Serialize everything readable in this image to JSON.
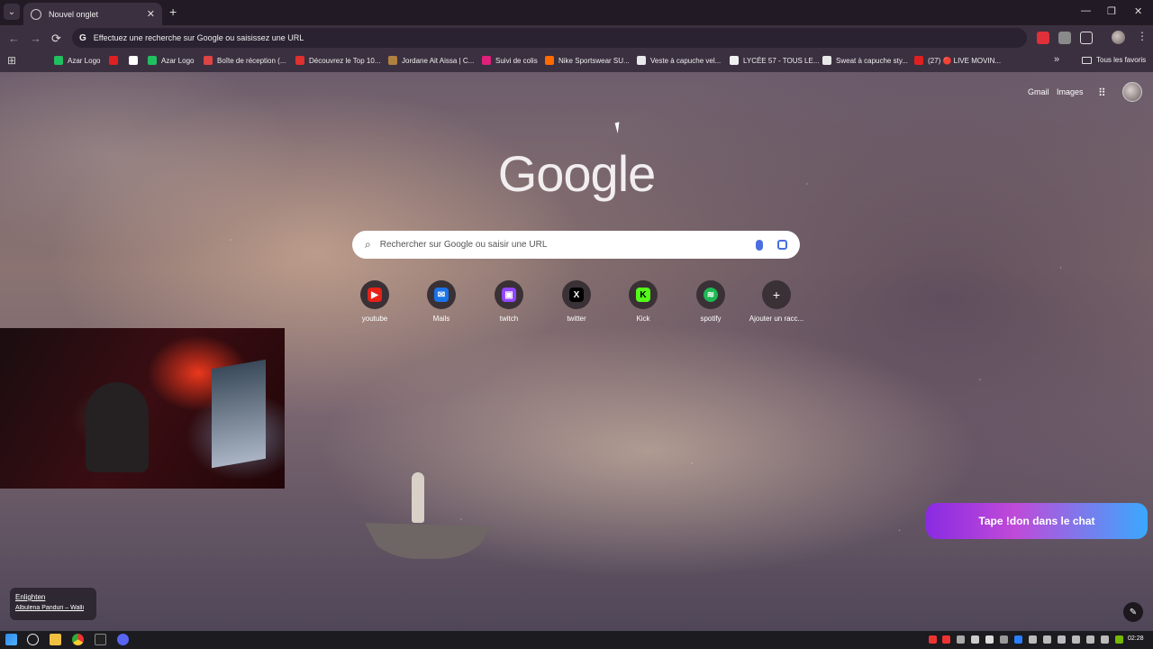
{
  "browser": {
    "tab_title": "Nouvel onglet",
    "tab_close": "✕",
    "new_tab": "+",
    "window_controls": [
      "—",
      "❐",
      "✕"
    ],
    "tab_search": "⌄"
  },
  "toolbar": {
    "back": "←",
    "forward": "→",
    "reload": "⟳",
    "omnibox_g": "G",
    "omnibox_placeholder": "Effectuez une recherche sur Google ou saisissez une URL",
    "menu": "⋮"
  },
  "bookmarks": {
    "items": [
      {
        "label": "Azar Logo",
        "color": "#20c060"
      },
      {
        "label": "",
        "color": "#e02020"
      },
      {
        "label": "",
        "color": "#ffffff"
      },
      {
        "label": "Azar Logo",
        "color": "#20c060"
      },
      {
        "label": "Boîte de réception (...",
        "color": "#d44"
      },
      {
        "label": "Découvrez le Top 10...",
        "color": "#e03030"
      },
      {
        "label": "Jordane Ait Aissa | C...",
        "color": "#b08040"
      },
      {
        "label": "Suivi de colis",
        "color": "#e0207a"
      },
      {
        "label": "Nike Sportswear SU...",
        "color": "#ff6a00"
      },
      {
        "label": "Veste à capuche vel...",
        "color": "#e8e8e8"
      },
      {
        "label": "LYCÉE 57 - TOUS LE...",
        "color": "#f0f0f0"
      },
      {
        "label": "Sweat à capuche sty...",
        "color": "#e8e8e8"
      },
      {
        "label": "(27) 🔴 LIVE MOVIN...",
        "color": "#e02020"
      }
    ],
    "more": "»",
    "all_favorites": "Tous les favoris"
  },
  "header_links": {
    "gmail": "Gmail",
    "images": "Images",
    "apps": "⋮⋮⋮"
  },
  "logo": "Google",
  "search": {
    "icon": "🔍",
    "placeholder": "Rechercher sur Google ou saisir une URL"
  },
  "shortcuts": [
    {
      "label": "youtube",
      "glyph": "▶",
      "color": "#e62117"
    },
    {
      "label": "Mails",
      "glyph": "✉",
      "color": "#1a73e8"
    },
    {
      "label": "twitch",
      "glyph": "▣",
      "color": "#9146ff"
    },
    {
      "label": "twitter",
      "glyph": "X",
      "color": "#000000"
    },
    {
      "label": "Kick",
      "glyph": "K",
      "color": "#53fc18"
    },
    {
      "label": "spotify",
      "glyph": "≋",
      "color": "#1db954"
    },
    {
      "label": "Ajouter un racc...",
      "glyph": "+",
      "color": "#3a3136"
    }
  ],
  "overlay": {
    "cta": "Tape !don dans le chat"
  },
  "credit": {
    "title": "Enlighten",
    "author": "Albulena Panduri – Walli"
  },
  "edit_icon": "✎",
  "taskbar": {
    "clock": "02:28"
  }
}
